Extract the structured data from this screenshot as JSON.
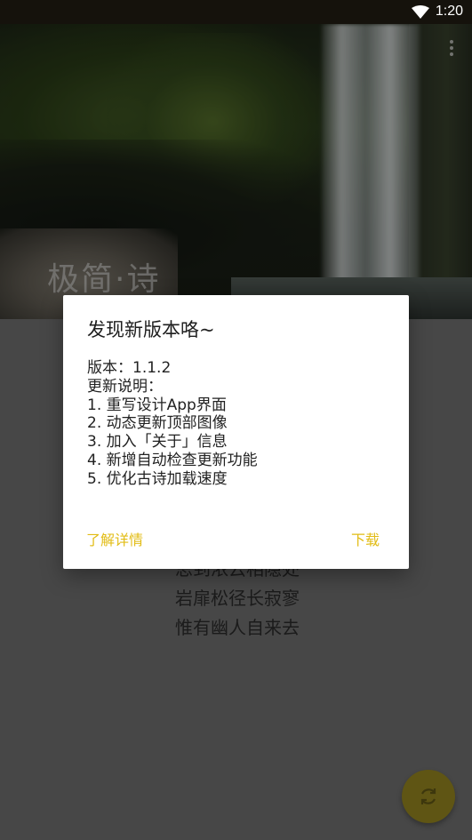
{
  "status_bar": {
    "time": "1:20"
  },
  "header": {
    "app_title": "极简·诗"
  },
  "poem": {
    "lines": [
      "思到浓云相隐处",
      "岩扉松径长寂寥",
      "惟有幽人自来去"
    ]
  },
  "dialog": {
    "title": "发现新版本咯~",
    "lines": [
      "版本：1.1.2",
      "更新说明：",
      "1. 重写设计App界面",
      "2. 动态更新顶部图像",
      "3. 加入「关于」信息",
      "4. 新增自动检查更新功能",
      "5. 优化古诗加载速度"
    ],
    "details_button": "了解详情",
    "download_button": "下载"
  },
  "colors": {
    "accent": "#e2bc14",
    "status_bar": "#15120c",
    "fab": "#5f5514",
    "scrim": "#7a7a7a"
  },
  "icons": {
    "status_wifi": "wifi-icon",
    "overflow_menu": "more-vert-icon",
    "fab": "refresh-icon"
  }
}
